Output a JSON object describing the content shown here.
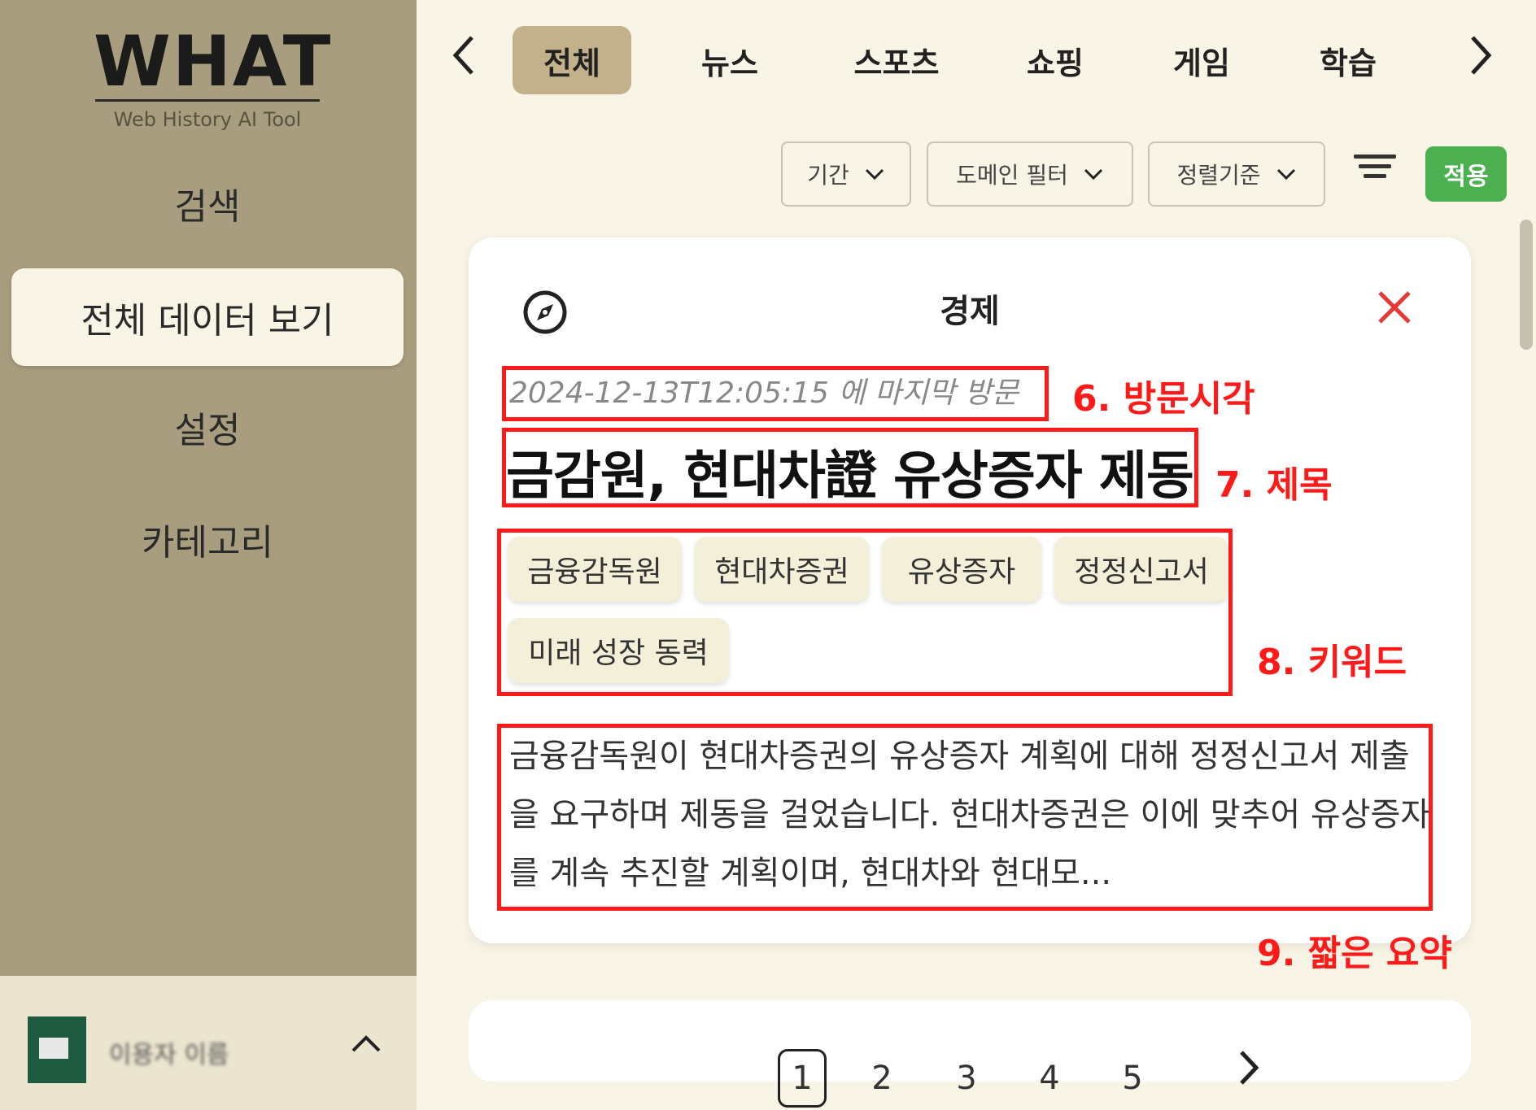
{
  "app": {
    "logo_title": "WHAT",
    "logo_subtitle": "Web History AI Tool"
  },
  "sidebar": {
    "items": [
      {
        "label": "검색"
      },
      {
        "label": "전체 데이터 보기",
        "active": true
      },
      {
        "label": "설정"
      },
      {
        "label": "카테고리"
      }
    ],
    "user": {
      "name": "이용자 이름",
      "toggle_icon": "chevron-up-icon"
    }
  },
  "tabs": [
    {
      "label": "전체",
      "active": true
    },
    {
      "label": "뉴스"
    },
    {
      "label": "스포츠"
    },
    {
      "label": "쇼핑"
    },
    {
      "label": "게임"
    },
    {
      "label": "학습"
    }
  ],
  "filters": {
    "period": "기간",
    "domain": "도메인 필터",
    "sort": "정렬기준",
    "apply": "적용",
    "apply_color": "#4caf50"
  },
  "card": {
    "category": "경제",
    "visit_time": "2024-12-13T12:05:15 에 마지막 방문",
    "title": "금감원, 현대차證 유상증자 제동",
    "keywords": [
      "금융감독원",
      "현대차증권",
      "유상증자",
      "정정신고서",
      "미래 성장 동력"
    ],
    "summary": "금융감독원이 현대차증권의 유상증자 계획에 대해 정정신고서 제출을 요구하며 제동을 걸었습니다. 현대차증권은 이에 맞추어 유상증자를 계속 추진할 계획이며, 현대차와 현대모..."
  },
  "annotations": {
    "visit_time_label": "6. 방문시각",
    "title_label": "7. 제목",
    "keywords_label": "8. 키워드",
    "summary_label": "9. 짧은 요약",
    "color": "#ff1a1a"
  },
  "pagination": {
    "pages": [
      "1",
      "2",
      "3",
      "4",
      "5"
    ],
    "current": "1"
  }
}
